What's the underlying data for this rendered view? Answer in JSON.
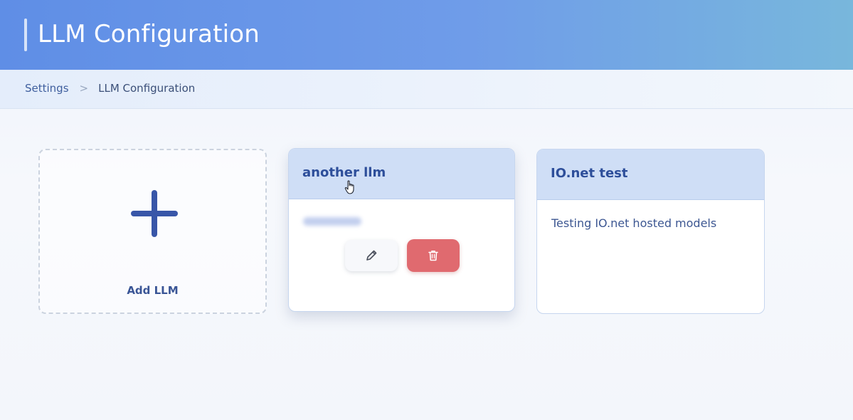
{
  "header": {
    "title": "LLM Configuration"
  },
  "breadcrumb": {
    "items": [
      "Settings",
      "LLM Configuration"
    ],
    "separator": ">"
  },
  "cards": {
    "add": {
      "label": "Add LLM",
      "icon": "plus-icon"
    },
    "llms": [
      {
        "name": "another llm",
        "description": "",
        "actions": {
          "edit_icon": "pencil-icon",
          "delete_icon": "trash-icon"
        }
      },
      {
        "name": "IO.net test",
        "description": "Testing IO.net hosted models"
      }
    ]
  },
  "colors": {
    "header_gradient_start": "#5f8ee6",
    "header_gradient_end": "#78b7dc",
    "accent": "#3856a8",
    "card_header": "#cfdef6",
    "delete": "#e06a6f"
  }
}
